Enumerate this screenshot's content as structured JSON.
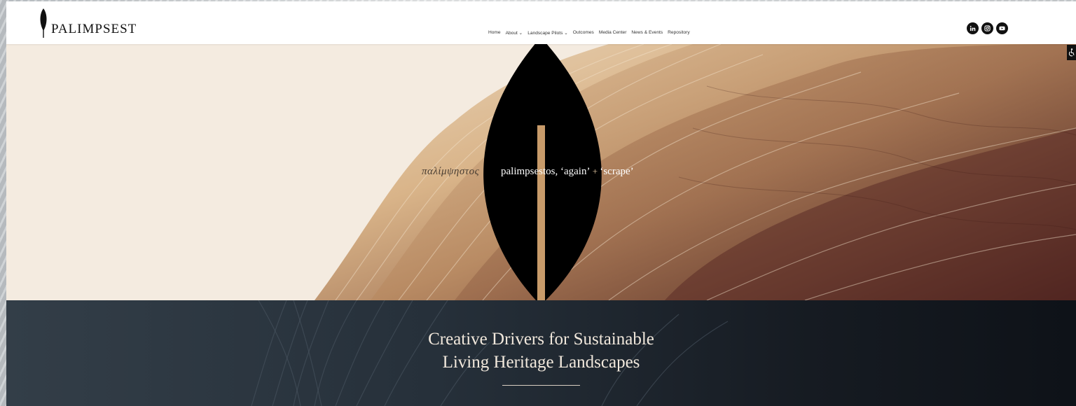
{
  "brand": {
    "name": "PALIMPSEST"
  },
  "nav": {
    "items": [
      {
        "label": "Home"
      },
      {
        "label": "About ⌄"
      },
      {
        "label": "Landscape Pilots ⌄"
      },
      {
        "label": "Outcomes"
      },
      {
        "label": "Media Center"
      },
      {
        "label": "News & Events"
      },
      {
        "label": "Repository"
      }
    ]
  },
  "social": {
    "icons": [
      "linkedin-icon",
      "instagram-icon",
      "youtube-icon"
    ]
  },
  "accessibility": {
    "icon": "accessibility-icon"
  },
  "hero": {
    "greek": "παλίμψηστος",
    "english_part1": "palimpsestos, ‘again’",
    "plus": " + ",
    "english_part2": "‘scrape’"
  },
  "band": {
    "headline_line1": "Creative Drivers for Sustainable",
    "headline_line2": "Living Heritage Landscapes"
  },
  "colors": {
    "hero_bg": "#f4ebe0",
    "band_bg": "#1c232b",
    "accent_tan": "#c9a06a",
    "accent_brown": "#5a3426",
    "leaf": "#000000"
  }
}
